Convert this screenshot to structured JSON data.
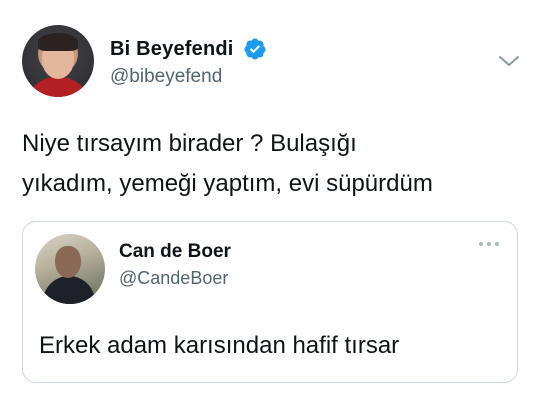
{
  "tweet": {
    "author_name": "Bi Beyefendi",
    "author_handle": "@bibeyefend",
    "verified": true,
    "text_lines": [
      "Niye tırsayım birader ? Bulaşığı",
      "yıkadım, yemeği yaptım, evi süpürdüm"
    ],
    "icons": {
      "verified": "verified-badge-icon",
      "menu": "chevron-down-icon"
    }
  },
  "quoted_tweet": {
    "author_name": "Can de Boer",
    "author_handle": "@CandeBoer",
    "text": "Erkek adam karısından hafif tırsar",
    "icons": {
      "menu": "more-dots-icon"
    }
  },
  "colors": {
    "verified_blue": "#1d9bf0",
    "secondary_text": "#536471",
    "border": "#cfd9de"
  }
}
